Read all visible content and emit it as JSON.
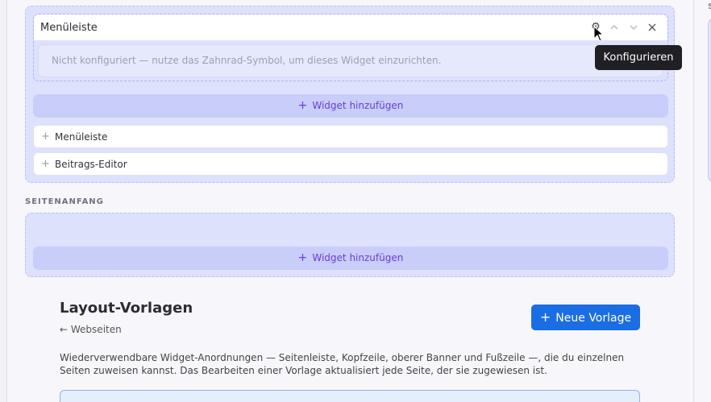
{
  "zone_top": {
    "widget": {
      "title": "Menüleiste",
      "placeholder_message": "Nicht konfiguriert — nutze das Zahnrad-Symbol, um dieses Widget einzurichten.",
      "icons": [
        "gear-icon",
        "chevron-up-icon",
        "chevron-down-icon",
        "close-icon"
      ]
    },
    "add_widget_label": "Widget hinzufügen",
    "options": [
      {
        "label": "Menüleiste"
      },
      {
        "label": "Beitrags-Editor"
      }
    ]
  },
  "section_header": {
    "label": "SEITENANFANG",
    "add_widget_label": "Widget hinzufügen"
  },
  "tooltip": {
    "text": "Konfigurieren"
  },
  "right_pane": {
    "label": "S"
  },
  "layout_templates": {
    "title": "Layout-Vorlagen",
    "back_link": "Webseiten",
    "new_button_label": "Neue Vorlage",
    "description": "Wiederverwendbare Widget-Anordnungen — Seitenleiste, Kopfzeile, oberer Banner und Fußzeile —, die du einzelnen Seiten zuweisen kannst. Das Bearbeiten einer Vorlage aktualisiert jede Seite, der sie zugewiesen ist."
  },
  "colors": {
    "accent": "#1a6de2",
    "add_widget_text": "#6a3fd3",
    "zone_bg": "#dde1fb"
  }
}
